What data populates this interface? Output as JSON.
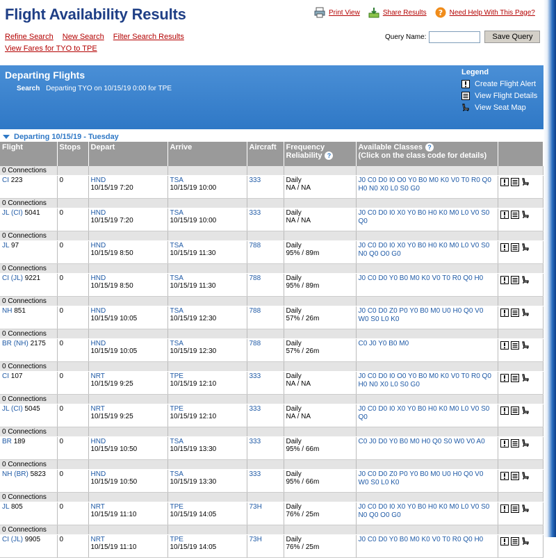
{
  "header": {
    "title": "Flight Availability Results",
    "print_label": "Print View",
    "share_label": "Share Results",
    "help_label": "Need Help With This Page?"
  },
  "nav": {
    "refine": "Refine Search",
    "new": "New Search",
    "filter": "Filter Search Results",
    "fares": "View Fares for TYO to TPE"
  },
  "query": {
    "label": "Query Name:",
    "value": "",
    "save_label": "Save Query"
  },
  "banner": {
    "title": "Departing Flights",
    "search_label": "Search",
    "search_text": "Departing TYO on 10/15/19 0:00 for TPE",
    "legend_title": "Legend",
    "legend_alert": "Create Flight Alert",
    "legend_details": "View Flight Details",
    "legend_seat": "View Seat Map"
  },
  "day_header": "Departing 10/15/19 - Tuesday",
  "columns": {
    "flight": "Flight",
    "stops": "Stops",
    "depart": "Depart",
    "arrive": "Arrive",
    "aircraft": "Aircraft",
    "frequency": "Frequency",
    "reliability": "Reliability",
    "classes": "Available Classes",
    "classes_hint": "(Click on the class code for details)"
  },
  "flights": [
    {
      "conn": "0 Connections",
      "code": "CI",
      "op": "",
      "num": "223",
      "stops": "0",
      "dep": "HND",
      "dep_time": "10/15/19 7:20",
      "arr": "TSA",
      "arr_time": "10/15/19 10:00",
      "aircraft": "333",
      "freq": "Daily",
      "rel": "NA / NA",
      "classes": "J0 C0 D0 I0 O0 Y0 B0 M0 K0 V0 T0 R0 Q0 H0 N0 X0 L0 S0 G0"
    },
    {
      "conn": "0 Connections",
      "code": "JL",
      "op": "(CI)",
      "num": "5041",
      "stops": "0",
      "dep": "HND",
      "dep_time": "10/15/19 7:20",
      "arr": "TSA",
      "arr_time": "10/15/19 10:00",
      "aircraft": "333",
      "freq": "Daily",
      "rel": "NA / NA",
      "classes": "J0 C0 D0 I0 X0 Y0 B0 H0 K0 M0 L0 V0 S0 Q0"
    },
    {
      "conn": "0 Connections",
      "code": "JL",
      "op": "",
      "num": "97",
      "stops": "0",
      "dep": "HND",
      "dep_time": "10/15/19 8:50",
      "arr": "TSA",
      "arr_time": "10/15/19 11:30",
      "aircraft": "788",
      "freq": "Daily",
      "rel": "95% / 89m",
      "classes": "J0 C0 D0 I0 X0 Y0 B0 H0 K0 M0 L0 V0 S0 N0 Q0 O0 G0"
    },
    {
      "conn": "0 Connections",
      "code": "CI",
      "op": "(JL)",
      "num": "9221",
      "stops": "0",
      "dep": "HND",
      "dep_time": "10/15/19 8:50",
      "arr": "TSA",
      "arr_time": "10/15/19 11:30",
      "aircraft": "788",
      "freq": "Daily",
      "rel": "95% / 89m",
      "classes": "J0 C0 D0 Y0 B0 M0 K0 V0 T0 R0 Q0 H0"
    },
    {
      "conn": "0 Connections",
      "code": "NH",
      "op": "",
      "num": "851",
      "stops": "0",
      "dep": "HND",
      "dep_time": "10/15/19 10:05",
      "arr": "TSA",
      "arr_time": "10/15/19 12:30",
      "aircraft": "788",
      "freq": "Daily",
      "rel": "57% / 26m",
      "classes": "J0 C0 D0 Z0 P0 Y0 B0 M0 U0 H0 Q0 V0 W0 S0 L0 K0"
    },
    {
      "conn": "0 Connections",
      "code": "BR",
      "op": "(NH)",
      "num": "2175",
      "stops": "0",
      "dep": "HND",
      "dep_time": "10/15/19 10:05",
      "arr": "TSA",
      "arr_time": "10/15/19 12:30",
      "aircraft": "788",
      "freq": "Daily",
      "rel": "57% / 26m",
      "classes": "C0 J0 Y0 B0 M0"
    },
    {
      "conn": "0 Connections",
      "code": "CI",
      "op": "",
      "num": "107",
      "stops": "0",
      "dep": "NRT",
      "dep_time": "10/15/19 9:25",
      "arr": "TPE",
      "arr_time": "10/15/19 12:10",
      "aircraft": "333",
      "freq": "Daily",
      "rel": "NA / NA",
      "classes": "J0 C0 D0 I0 O0 Y0 B0 M0 K0 V0 T0 R0 Q0 H0 N0 X0 L0 S0 G0"
    },
    {
      "conn": "0 Connections",
      "code": "JL",
      "op": "(CI)",
      "num": "5045",
      "stops": "0",
      "dep": "NRT",
      "dep_time": "10/15/19 9:25",
      "arr": "TPE",
      "arr_time": "10/15/19 12:10",
      "aircraft": "333",
      "freq": "Daily",
      "rel": "NA / NA",
      "classes": "J0 C0 D0 I0 X0 Y0 B0 H0 K0 M0 L0 V0 S0 Q0"
    },
    {
      "conn": "0 Connections",
      "code": "BR",
      "op": "",
      "num": "189",
      "stops": "0",
      "dep": "HND",
      "dep_time": "10/15/19 10:50",
      "arr": "TSA",
      "arr_time": "10/15/19 13:30",
      "aircraft": "333",
      "freq": "Daily",
      "rel": "95% / 66m",
      "classes": "C0 J0 D0 Y0 B0 M0 H0 Q0 S0 W0 V0 A0"
    },
    {
      "conn": "0 Connections",
      "code": "NH",
      "op": "(BR)",
      "num": "5823",
      "stops": "0",
      "dep": "HND",
      "dep_time": "10/15/19 10:50",
      "arr": "TSA",
      "arr_time": "10/15/19 13:30",
      "aircraft": "333",
      "freq": "Daily",
      "rel": "95% / 66m",
      "classes": "J0 C0 D0 Z0 P0 Y0 B0 M0 U0 H0 Q0 V0 W0 S0 L0 K0"
    },
    {
      "conn": "0 Connections",
      "code": "JL",
      "op": "",
      "num": "805",
      "stops": "0",
      "dep": "NRT",
      "dep_time": "10/15/19 11:10",
      "arr": "TPE",
      "arr_time": "10/15/19 14:05",
      "aircraft": "73H",
      "freq": "Daily",
      "rel": "76% / 25m",
      "classes": "J0 C0 D0 I0 X0 Y0 B0 H0 K0 M0 L0 V0 S0 N0 Q0 O0 G0"
    },
    {
      "conn": "0 Connections",
      "code": "CI",
      "op": "(JL)",
      "num": "9905",
      "stops": "0",
      "dep": "NRT",
      "dep_time": "10/15/19 11:10",
      "arr": "TPE",
      "arr_time": "10/15/19 14:05",
      "aircraft": "73H",
      "freq": "Daily",
      "rel": "76% / 25m",
      "classes": "J0 C0 D0 Y0 B0 M0 K0 V0 T0 R0 Q0 H0"
    }
  ],
  "icons": {
    "alert": "alert-icon",
    "details": "details-icon",
    "seat": "seat-icon"
  }
}
